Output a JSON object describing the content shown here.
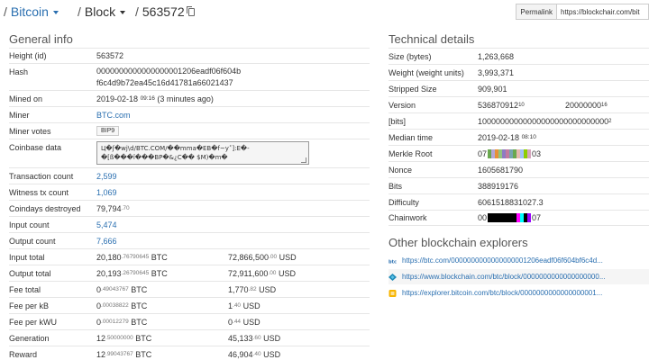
{
  "breadcrumb": {
    "chain": "Bitcoin",
    "section": "Block",
    "block_id": "563572"
  },
  "permalink": {
    "button": "Permalink",
    "url": "https://blockchair.com/bit"
  },
  "general": {
    "title": "General info",
    "height_label": "Height (id)",
    "height": "563572",
    "hash_label": "Hash",
    "hash_line1": "0000000000000000001206eadf06f604b",
    "hash_line2": "f6c4d9b72ea45c16d41781a66021437",
    "mined_label": "Mined on",
    "mined_date": "2019-02-18",
    "mined_time": "09:16",
    "mined_ago": "(3 minutes ago)",
    "miner_label": "Miner",
    "miner": "BTC.com",
    "votes_label": "Miner votes",
    "votes": "BIP9",
    "coinbase_label": "Coinbase data",
    "coinbase_line1": "Ц�ʃ�wj\\d/BTC.COM/��mma�EB�f~y˂]:E�-",
    "coinbase_line2": "�[ß���ǐ���ΒΡ�&¿C�� $M)�m�",
    "tx_label": "Transaction count",
    "tx": "2,599",
    "witness_label": "Witness tx count",
    "witness": "1,069",
    "cdd_label": "Coindays destroyed",
    "cdd_int": "79,794",
    "cdd_dec": ".70",
    "input_count_label": "Input count",
    "input_count": "5,474",
    "output_count_label": "Output count",
    "output_count": "7,666",
    "input_total_label": "Input total",
    "input_total_int": "20,180",
    "input_total_dec": ".76790645",
    "input_total_unit": "BTC",
    "input_total_usd_int": "72,866,500",
    "input_total_usd_dec": ".00",
    "input_total_usd_unit": "USD",
    "output_total_label": "Output total",
    "output_total_int": "20,193",
    "output_total_dec": ".26790645",
    "output_total_unit": "BTC",
    "output_total_usd_int": "72,911,600",
    "output_total_usd_dec": ".00",
    "output_total_usd_unit": "USD",
    "fee_total_label": "Fee total",
    "fee_total_int": "0",
    "fee_total_dec": ".49043767",
    "fee_total_unit": "BTC",
    "fee_total_usd_int": "1,770",
    "fee_total_usd_dec": ".82",
    "fee_total_usd_unit": "USD",
    "fee_kb_label": "Fee per kB",
    "fee_kb_int": "0",
    "fee_kb_dec": ".00038822",
    "fee_kb_unit": "BTC",
    "fee_kb_usd_int": "1",
    "fee_kb_usd_dec": ".40",
    "fee_kb_usd_unit": "USD",
    "fee_kwu_label": "Fee per kWU",
    "fee_kwu_int": "0",
    "fee_kwu_dec": ".00012279",
    "fee_kwu_unit": "BTC",
    "fee_kwu_usd_int": "0",
    "fee_kwu_usd_dec": ".44",
    "fee_kwu_usd_unit": "USD",
    "generation_label": "Generation",
    "generation_int": "12",
    "generation_dec": ".50000000",
    "generation_unit": "BTC",
    "generation_usd_int": "45,133",
    "generation_usd_dec": ".60",
    "generation_usd_unit": "USD",
    "reward_label": "Reward",
    "reward_int": "12",
    "reward_dec": ".99043767",
    "reward_unit": "BTC",
    "reward_usd_int": "46,904",
    "reward_usd_dec": ".40",
    "reward_usd_unit": "USD"
  },
  "technical": {
    "title": "Technical details",
    "size_label": "Size (bytes)",
    "size": "1,263,668",
    "weight_label": "Weight (weight units)",
    "weight": "3,993,371",
    "stripped_label": "Stripped Size",
    "stripped": "909,901",
    "version_label": "Version",
    "version_dec": "536870912",
    "version_dec_base": "10",
    "version_hex": "20000000",
    "version_hex_base": "16",
    "bits_bin_label": "[bits]",
    "bits_bin": "10000000000000000000000000000",
    "bits_bin_base": "2",
    "median_label": "Median time",
    "median_date": "2019-02-18",
    "median_time": "08:10",
    "merkle_label": "Merkle Root",
    "merkle_start": "07",
    "merkle_end": "03",
    "nonce_label": "Nonce",
    "nonce": "1605681790",
    "bits_label": "Bits",
    "bits": "388919176",
    "difficulty_label": "Difficulty",
    "difficulty": "6061518831027.3",
    "chainwork_label": "Chainwork",
    "chainwork_start": "00",
    "chainwork_end": "07"
  },
  "merkle_colors": [
    "#6aa84f",
    "#b4a7d6",
    "#e69138",
    "#93c47d",
    "#8e7cc3",
    "#c27ba0",
    "#76a5af",
    "#6aa84f",
    "#e6b8af",
    "#a4c2f4",
    "#8fce00",
    "#d5a6bd"
  ],
  "chainwork_colors": [
    "#000000",
    "#000000",
    "#000000",
    "#000000",
    "#000000",
    "#000000",
    "#000000",
    "#000000",
    "#ff00ff",
    "#00ffff",
    "#000000",
    "#9900ff"
  ],
  "explorers": {
    "title": "Other blockchain explorers",
    "items": [
      {
        "icon": "btc-com-icon",
        "url": "https://btc.com/0000000000000000001206eadf06f604bf6c4d..."
      },
      {
        "icon": "blockchain-com-icon",
        "url": "https://www.blockchain.com/btc/block/0000000000000000000..."
      },
      {
        "icon": "bitcoin-com-icon",
        "url": "https://explorer.bitcoin.com/btc/block/0000000000000000001..."
      }
    ]
  }
}
